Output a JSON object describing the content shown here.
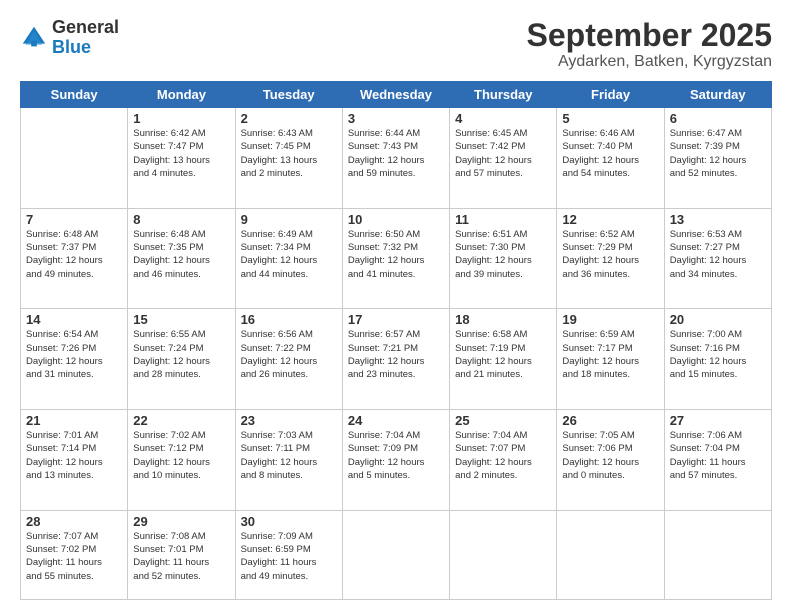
{
  "header": {
    "logo_general": "General",
    "logo_blue": "Blue",
    "month_title": "September 2025",
    "location": "Aydarken, Batken, Kyrgyzstan"
  },
  "days_of_week": [
    "Sunday",
    "Monday",
    "Tuesday",
    "Wednesday",
    "Thursday",
    "Friday",
    "Saturday"
  ],
  "weeks": [
    [
      {
        "num": "",
        "info": ""
      },
      {
        "num": "1",
        "info": "Sunrise: 6:42 AM\nSunset: 7:47 PM\nDaylight: 13 hours\nand 4 minutes."
      },
      {
        "num": "2",
        "info": "Sunrise: 6:43 AM\nSunset: 7:45 PM\nDaylight: 13 hours\nand 2 minutes."
      },
      {
        "num": "3",
        "info": "Sunrise: 6:44 AM\nSunset: 7:43 PM\nDaylight: 12 hours\nand 59 minutes."
      },
      {
        "num": "4",
        "info": "Sunrise: 6:45 AM\nSunset: 7:42 PM\nDaylight: 12 hours\nand 57 minutes."
      },
      {
        "num": "5",
        "info": "Sunrise: 6:46 AM\nSunset: 7:40 PM\nDaylight: 12 hours\nand 54 minutes."
      },
      {
        "num": "6",
        "info": "Sunrise: 6:47 AM\nSunset: 7:39 PM\nDaylight: 12 hours\nand 52 minutes."
      }
    ],
    [
      {
        "num": "7",
        "info": "Sunrise: 6:48 AM\nSunset: 7:37 PM\nDaylight: 12 hours\nand 49 minutes."
      },
      {
        "num": "8",
        "info": "Sunrise: 6:48 AM\nSunset: 7:35 PM\nDaylight: 12 hours\nand 46 minutes."
      },
      {
        "num": "9",
        "info": "Sunrise: 6:49 AM\nSunset: 7:34 PM\nDaylight: 12 hours\nand 44 minutes."
      },
      {
        "num": "10",
        "info": "Sunrise: 6:50 AM\nSunset: 7:32 PM\nDaylight: 12 hours\nand 41 minutes."
      },
      {
        "num": "11",
        "info": "Sunrise: 6:51 AM\nSunset: 7:30 PM\nDaylight: 12 hours\nand 39 minutes."
      },
      {
        "num": "12",
        "info": "Sunrise: 6:52 AM\nSunset: 7:29 PM\nDaylight: 12 hours\nand 36 minutes."
      },
      {
        "num": "13",
        "info": "Sunrise: 6:53 AM\nSunset: 7:27 PM\nDaylight: 12 hours\nand 34 minutes."
      }
    ],
    [
      {
        "num": "14",
        "info": "Sunrise: 6:54 AM\nSunset: 7:26 PM\nDaylight: 12 hours\nand 31 minutes."
      },
      {
        "num": "15",
        "info": "Sunrise: 6:55 AM\nSunset: 7:24 PM\nDaylight: 12 hours\nand 28 minutes."
      },
      {
        "num": "16",
        "info": "Sunrise: 6:56 AM\nSunset: 7:22 PM\nDaylight: 12 hours\nand 26 minutes."
      },
      {
        "num": "17",
        "info": "Sunrise: 6:57 AM\nSunset: 7:21 PM\nDaylight: 12 hours\nand 23 minutes."
      },
      {
        "num": "18",
        "info": "Sunrise: 6:58 AM\nSunset: 7:19 PM\nDaylight: 12 hours\nand 21 minutes."
      },
      {
        "num": "19",
        "info": "Sunrise: 6:59 AM\nSunset: 7:17 PM\nDaylight: 12 hours\nand 18 minutes."
      },
      {
        "num": "20",
        "info": "Sunrise: 7:00 AM\nSunset: 7:16 PM\nDaylight: 12 hours\nand 15 minutes."
      }
    ],
    [
      {
        "num": "21",
        "info": "Sunrise: 7:01 AM\nSunset: 7:14 PM\nDaylight: 12 hours\nand 13 minutes."
      },
      {
        "num": "22",
        "info": "Sunrise: 7:02 AM\nSunset: 7:12 PM\nDaylight: 12 hours\nand 10 minutes."
      },
      {
        "num": "23",
        "info": "Sunrise: 7:03 AM\nSunset: 7:11 PM\nDaylight: 12 hours\nand 8 minutes."
      },
      {
        "num": "24",
        "info": "Sunrise: 7:04 AM\nSunset: 7:09 PM\nDaylight: 12 hours\nand 5 minutes."
      },
      {
        "num": "25",
        "info": "Sunrise: 7:04 AM\nSunset: 7:07 PM\nDaylight: 12 hours\nand 2 minutes."
      },
      {
        "num": "26",
        "info": "Sunrise: 7:05 AM\nSunset: 7:06 PM\nDaylight: 12 hours\nand 0 minutes."
      },
      {
        "num": "27",
        "info": "Sunrise: 7:06 AM\nSunset: 7:04 PM\nDaylight: 11 hours\nand 57 minutes."
      }
    ],
    [
      {
        "num": "28",
        "info": "Sunrise: 7:07 AM\nSunset: 7:02 PM\nDaylight: 11 hours\nand 55 minutes."
      },
      {
        "num": "29",
        "info": "Sunrise: 7:08 AM\nSunset: 7:01 PM\nDaylight: 11 hours\nand 52 minutes."
      },
      {
        "num": "30",
        "info": "Sunrise: 7:09 AM\nSunset: 6:59 PM\nDaylight: 11 hours\nand 49 minutes."
      },
      {
        "num": "",
        "info": ""
      },
      {
        "num": "",
        "info": ""
      },
      {
        "num": "",
        "info": ""
      },
      {
        "num": "",
        "info": ""
      }
    ]
  ]
}
